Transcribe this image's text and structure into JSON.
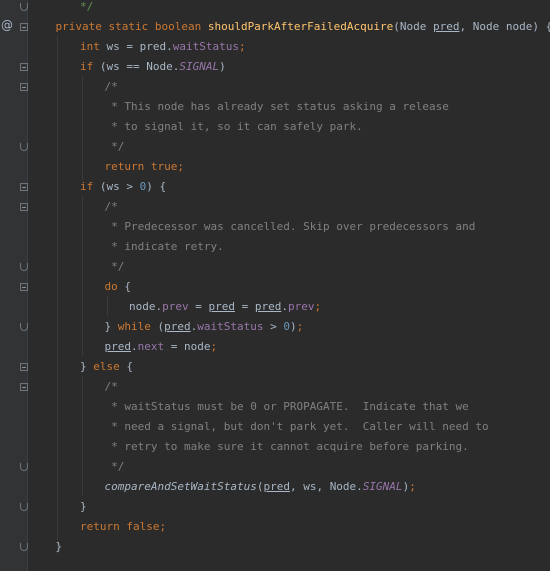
{
  "editor": {
    "language": "java",
    "gutter_mark": "@",
    "lines": [
      {
        "indent": 2,
        "tokens": [
          {
            "t": "*/",
            "c": "doc"
          }
        ]
      },
      {
        "indent": 1,
        "tokens": [
          {
            "t": "private static boolean ",
            "c": "kw"
          },
          {
            "t": "shouldParkAfterFailedAcquire",
            "c": "fn"
          },
          {
            "t": "(Node ",
            "c": "plain"
          },
          {
            "t": "pred",
            "c": "ul"
          },
          {
            "t": ", Node node) {",
            "c": "plain"
          }
        ]
      },
      {
        "indent": 2,
        "tokens": [
          {
            "t": "int ",
            "c": "kw"
          },
          {
            "t": "ws = pred.",
            "c": "plain"
          },
          {
            "t": "waitStatus",
            "c": "field"
          },
          {
            "t": ";",
            "c": "kw"
          }
        ]
      },
      {
        "indent": 2,
        "tokens": [
          {
            "t": "if ",
            "c": "kw"
          },
          {
            "t": "(ws == Node.",
            "c": "plain"
          },
          {
            "t": "SIGNAL",
            "c": "static"
          },
          {
            "t": ")",
            "c": "plain"
          }
        ]
      },
      {
        "indent": 3,
        "tokens": [
          {
            "t": "/*",
            "c": "cm"
          }
        ]
      },
      {
        "indent": 3,
        "tokens": [
          {
            "t": " * This node has already set status asking a release",
            "c": "cm"
          }
        ]
      },
      {
        "indent": 3,
        "tokens": [
          {
            "t": " * to signal it, so it can safely park.",
            "c": "cm"
          }
        ]
      },
      {
        "indent": 3,
        "tokens": [
          {
            "t": " */",
            "c": "cm"
          }
        ]
      },
      {
        "indent": 3,
        "tokens": [
          {
            "t": "return true",
            "c": "kw"
          },
          {
            "t": ";",
            "c": "kw"
          }
        ]
      },
      {
        "indent": 2,
        "tokens": [
          {
            "t": "if ",
            "c": "kw"
          },
          {
            "t": "(ws > ",
            "c": "plain"
          },
          {
            "t": "0",
            "c": "num"
          },
          {
            "t": ") {",
            "c": "plain"
          }
        ]
      },
      {
        "indent": 3,
        "tokens": [
          {
            "t": "/*",
            "c": "cm"
          }
        ]
      },
      {
        "indent": 3,
        "tokens": [
          {
            "t": " * Predecessor was cancelled. Skip over predecessors and",
            "c": "cm"
          }
        ]
      },
      {
        "indent": 3,
        "tokens": [
          {
            "t": " * indicate retry.",
            "c": "cm"
          }
        ]
      },
      {
        "indent": 3,
        "tokens": [
          {
            "t": " */",
            "c": "cm"
          }
        ]
      },
      {
        "indent": 3,
        "tokens": [
          {
            "t": "do ",
            "c": "kw"
          },
          {
            "t": "{",
            "c": "plain"
          }
        ]
      },
      {
        "indent": 4,
        "tokens": [
          {
            "t": "node.",
            "c": "plain"
          },
          {
            "t": "prev",
            "c": "field"
          },
          {
            "t": " = ",
            "c": "plain"
          },
          {
            "t": "pred",
            "c": "ul"
          },
          {
            "t": " = ",
            "c": "plain"
          },
          {
            "t": "pred",
            "c": "ul"
          },
          {
            "t": ".",
            "c": "plain"
          },
          {
            "t": "prev",
            "c": "field"
          },
          {
            "t": ";",
            "c": "kw"
          }
        ]
      },
      {
        "indent": 3,
        "tokens": [
          {
            "t": "} ",
            "c": "plain"
          },
          {
            "t": "while ",
            "c": "kw"
          },
          {
            "t": "(",
            "c": "plain"
          },
          {
            "t": "pred",
            "c": "ul"
          },
          {
            "t": ".",
            "c": "plain"
          },
          {
            "t": "waitStatus",
            "c": "field"
          },
          {
            "t": " > ",
            "c": "plain"
          },
          {
            "t": "0",
            "c": "num"
          },
          {
            "t": ")",
            "c": "plain"
          },
          {
            "t": ";",
            "c": "kw"
          }
        ]
      },
      {
        "indent": 3,
        "tokens": [
          {
            "t": "pred",
            "c": "ul"
          },
          {
            "t": ".",
            "c": "plain"
          },
          {
            "t": "next",
            "c": "field"
          },
          {
            "t": " = node",
            "c": "plain"
          },
          {
            "t": ";",
            "c": "kw"
          }
        ]
      },
      {
        "indent": 2,
        "tokens": [
          {
            "t": "} ",
            "c": "plain"
          },
          {
            "t": "else ",
            "c": "kw"
          },
          {
            "t": "{",
            "c": "plain"
          }
        ]
      },
      {
        "indent": 3,
        "tokens": [
          {
            "t": "/*",
            "c": "cm"
          }
        ]
      },
      {
        "indent": 3,
        "tokens": [
          {
            "t": " * waitStatus must be 0 or PROPAGATE.  Indicate that we",
            "c": "cm"
          }
        ]
      },
      {
        "indent": 3,
        "tokens": [
          {
            "t": " * need a signal, but don't park yet.  Caller will need to",
            "c": "cm"
          }
        ]
      },
      {
        "indent": 3,
        "tokens": [
          {
            "t": " * retry to make sure it cannot acquire before parking.",
            "c": "cm"
          }
        ]
      },
      {
        "indent": 3,
        "tokens": [
          {
            "t": " */",
            "c": "cm"
          }
        ]
      },
      {
        "indent": 3,
        "tokens": [
          {
            "t": "compareAndSetWaitStatus",
            "c": "italic"
          },
          {
            "t": "(",
            "c": "plain"
          },
          {
            "t": "pred",
            "c": "ul"
          },
          {
            "t": ", ws, Node.",
            "c": "plain"
          },
          {
            "t": "SIGNAL",
            "c": "static"
          },
          {
            "t": ")",
            "c": "plain"
          },
          {
            "t": ";",
            "c": "kw"
          }
        ]
      },
      {
        "indent": 2,
        "tokens": [
          {
            "t": "}",
            "c": "plain"
          }
        ]
      },
      {
        "indent": 2,
        "tokens": [
          {
            "t": "return false",
            "c": "kw"
          },
          {
            "t": ";",
            "c": "kw"
          }
        ]
      },
      {
        "indent": 1,
        "tokens": [
          {
            "t": "}",
            "c": "plain"
          }
        ]
      }
    ]
  }
}
